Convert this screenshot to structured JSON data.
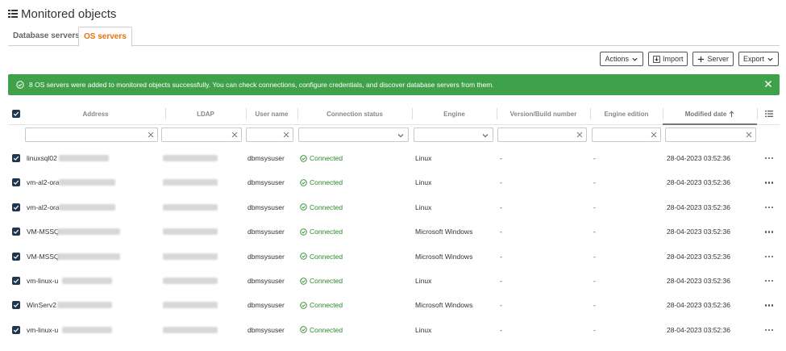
{
  "page": {
    "title": "Monitored objects"
  },
  "tabs": [
    {
      "label": "Database servers",
      "active": false
    },
    {
      "label": "OS servers",
      "active": true
    }
  ],
  "toolbar": {
    "actions_label": "Actions",
    "import_label": "Import",
    "server_label": "Server",
    "export_label": "Export"
  },
  "banner": {
    "message": "8 OS servers were added to monitored objects successfully. You can check connections, configure credentials, and discover database servers from them.",
    "color": "#3fa24a"
  },
  "columns": {
    "address": "Address",
    "ldap": "LDAP",
    "user_name": "User name",
    "connection_status": "Connection status",
    "engine": "Engine",
    "version": "Version/Build number",
    "edition": "Engine edition",
    "modified_date": "Modified date"
  },
  "rows": [
    {
      "address": "linuxsql02",
      "user": "dbmsysuser",
      "status": "Connected",
      "engine": "Linux",
      "version": "-",
      "edition": "-",
      "modified": "28-04-2023 03:52:36"
    },
    {
      "address": "vm-al2-ora",
      "user": "dbmsysuser",
      "status": "Connected",
      "engine": "Linux",
      "version": "-",
      "edition": "-",
      "modified": "28-04-2023 03:52:36"
    },
    {
      "address": "vm-al2-ora",
      "user": "dbmsysuser",
      "status": "Connected",
      "engine": "Linux",
      "version": "-",
      "edition": "-",
      "modified": "28-04-2023 03:52:36"
    },
    {
      "address": "VM-MSSQ",
      "user": "dbmsysuser",
      "status": "Connected",
      "engine": "Microsoft Windows",
      "version": "-",
      "edition": "-",
      "modified": "28-04-2023 03:52:36"
    },
    {
      "address": "VM-MSSQ",
      "user": "dbmsysuser",
      "status": "Connected",
      "engine": "Microsoft Windows",
      "version": "-",
      "edition": "-",
      "modified": "28-04-2023 03:52:36"
    },
    {
      "address": "vm-linux-u",
      "user": "dbmsysuser",
      "status": "Connected",
      "engine": "Linux",
      "version": "-",
      "edition": "-",
      "modified": "28-04-2023 03:52:36"
    },
    {
      "address": "WinServ2",
      "user": "dbmsysuser",
      "status": "Connected",
      "engine": "Microsoft Windows",
      "version": "-",
      "edition": "-",
      "modified": "28-04-2023 03:52:36"
    },
    {
      "address": "vm-linux-u",
      "user": "dbmsysuser",
      "status": "Connected",
      "engine": "Linux",
      "version": "-",
      "edition": "-",
      "modified": "28-04-2023 03:52:36"
    }
  ],
  "colors": {
    "accent": "#e8730a",
    "success": "#2a8a2a",
    "checkbox": "#1f3650"
  }
}
